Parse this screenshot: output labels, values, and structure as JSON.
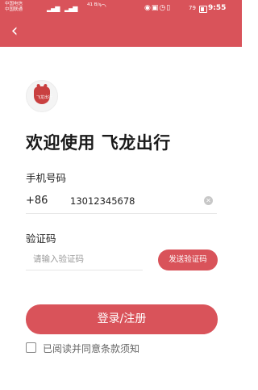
{
  "status_bar": {
    "carrier_1": "中国电信",
    "carrier_2": "中国联通",
    "signal_icon": "signal-icon",
    "network_speed": "41 B/s",
    "wifi_icon": "wifi-icon",
    "right_icons": [
      "eye-icon",
      "nfc-icon",
      "alarm-icon",
      "vibrate-icon"
    ],
    "battery_percent": "79",
    "time": "9:55"
  },
  "nav": {
    "back_icon": "chevron-left-icon",
    "accent_color": "#d9535a"
  },
  "logo": {
    "icon": "app-logo-icon",
    "brand_text": "飞龙出行"
  },
  "welcome_title": "欢迎使用 飞龙出行",
  "phone": {
    "label": "手机号码",
    "country_code": "+86",
    "value": "13012345678",
    "clear_icon": "clear-icon"
  },
  "code": {
    "label": "验证码",
    "placeholder": "请输入验证码",
    "send_button": "发送验证码"
  },
  "login_button": "登录/注册",
  "agreement": {
    "checked": false,
    "text": "已阅读并同意条款须知"
  }
}
